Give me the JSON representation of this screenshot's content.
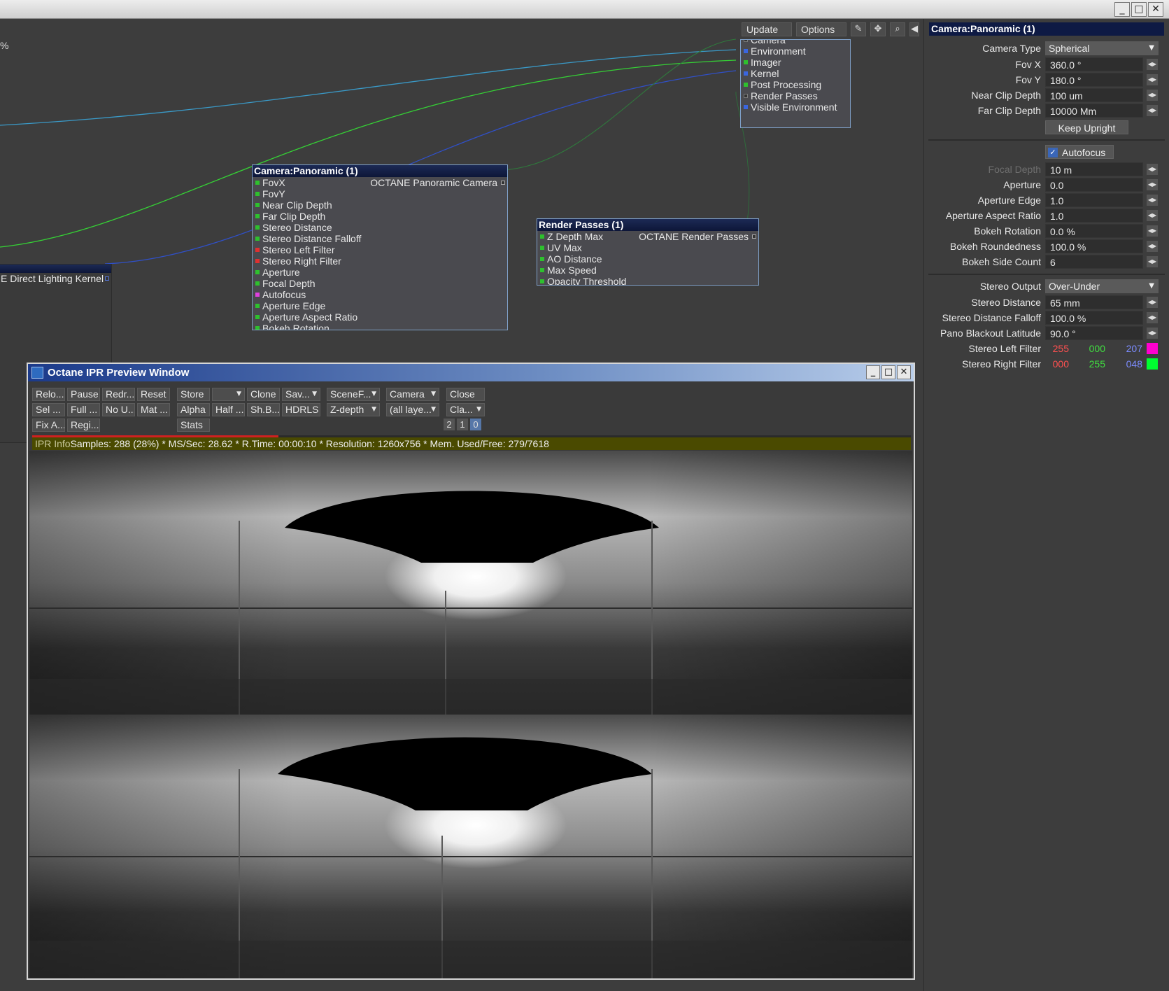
{
  "app": {
    "window_controls": [
      "_",
      "□",
      "✕"
    ]
  },
  "node_editor": {
    "percent_label": "%",
    "toolbar": {
      "update": "Update",
      "options": "Options"
    },
    "output_node": {
      "items": [
        "Camera",
        "Environment",
        "Imager",
        "Kernel",
        "Post Processing",
        "Render Passes",
        "Visible Environment"
      ]
    },
    "direct_lighting_node": {
      "title": "",
      "label": "E Direct Lighting Kernel"
    },
    "camera_node": {
      "title": "Camera:Panoramic (1)",
      "output": "OCTANE Panoramic Camera",
      "inputs": [
        "FovX",
        "FovY",
        "Near Clip Depth",
        "Far Clip Depth",
        "Stereo Distance",
        "Stereo Distance Falloff",
        "Stereo Left Filter",
        "Stereo Right Filter",
        "Aperture",
        "Focal Depth",
        "Autofocus",
        "Aperture Edge",
        "Aperture Aspect Ratio",
        "Bokeh Rotation"
      ]
    },
    "render_passes_node": {
      "title": "Render Passes (1)",
      "output": "OCTANE Render Passes",
      "inputs": [
        "Z Depth Max",
        "UV Max",
        "AO Distance",
        "Max Speed",
        "Opacity Threshold"
      ]
    }
  },
  "panel": {
    "title": "Camera:Panoramic (1)",
    "camera_type_label": "Camera Type",
    "camera_type": "Spherical",
    "fovx_label": "Fov X",
    "fovx": "360.0 °",
    "fovy_label": "Fov Y",
    "fovy": "180.0 °",
    "near_label": "Near Clip Depth",
    "near": "100 um",
    "far_label": "Far Clip Depth",
    "far": "10000 Mm",
    "keep_upright": "Keep Upright",
    "autofocus": "Autofocus",
    "focal_depth_label": "Focal Depth",
    "focal_depth": "10 m",
    "aperture_label": "Aperture",
    "aperture": "0.0",
    "aperture_edge_label": "Aperture Edge",
    "aperture_edge": "1.0",
    "aspect_label": "Aperture Aspect Ratio",
    "aspect": "1.0",
    "bokeh_rot_label": "Bokeh Rotation",
    "bokeh_rot": "0.0 %",
    "bokeh_round_label": "Bokeh Roundedness",
    "bokeh_round": "100.0 %",
    "bokeh_side_label": "Bokeh Side Count",
    "bokeh_side": "6",
    "stereo_output_label": "Stereo Output",
    "stereo_output": "Over-Under",
    "stereo_dist_label": "Stereo Distance",
    "stereo_dist": "65 mm",
    "stereo_falloff_label": "Stereo Distance Falloff",
    "stereo_falloff": "100.0 %",
    "pano_blackout_label": "Pano Blackout Latitude",
    "pano_blackout": "90.0 °",
    "left_filter_label": "Stereo Left Filter",
    "left_filter": {
      "r": "255",
      "g": "000",
      "b": "207",
      "swatch": "#ff00cf"
    },
    "right_filter_label": "Stereo Right Filter",
    "right_filter": {
      "r": "000",
      "g": "255",
      "b": "048",
      "swatch": "#00ff30"
    }
  },
  "ipr": {
    "title": "Octane IPR Preview Window",
    "row1": {
      "relo": "Relo...",
      "pause": "Pause",
      "redr": "Redr...",
      "reset": "Reset",
      "store": "Store",
      "blank": "",
      "clone": "Clone",
      "sav": "Sav...",
      "scenef": "SceneF...",
      "camera": "Camera",
      "close": "Close"
    },
    "row2": {
      "sel": "Sel ...",
      "full": "Full ...",
      "nou": "No U...",
      "mat": "Mat ...",
      "alpha": "Alpha",
      "half": "Half ...",
      "shb": "Sh.B...",
      "hdrls": "HDRLS",
      "zdepth": "Z-depth",
      "layers": "(all laye...",
      "cla": "Cla..."
    },
    "row3": {
      "fixa": "Fix A...",
      "regi": "Regi...",
      "stats": "Stats"
    },
    "pages": [
      "2",
      "1",
      "0"
    ],
    "progress": 0.28,
    "info_label": "IPR Info",
    "info_text": "Samples: 288 (28%)  *  MS/Sec: 28.62  *  R.Time: 00:00:10  *  Resolution: 1260x756  *  Mem. Used/Free: 279/7618"
  }
}
